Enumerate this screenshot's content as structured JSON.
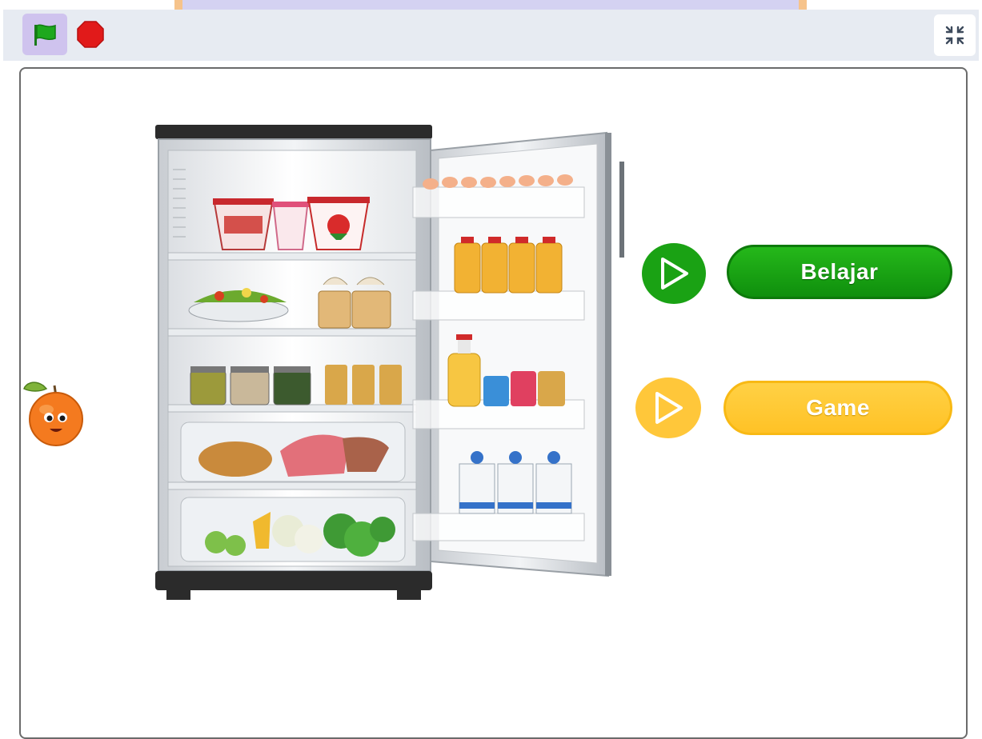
{
  "toolbar": {
    "green_flag": "green-flag-icon",
    "stop": "stop-sign-icon",
    "fullscreen_exit": "exit-fullscreen-icon"
  },
  "stage": {
    "menu": {
      "belajar_label": "Belajar",
      "game_label": "Game"
    }
  },
  "colors": {
    "toolbar_bg": "#e7ebf2",
    "flag_bg": "#cfc3ee",
    "flag_green": "#1ea81e",
    "stop_red": "#e11a1a",
    "belajar_green": "#1aa214",
    "game_yellow": "#ffc73a",
    "orange_sprite": "#f47a1f"
  }
}
